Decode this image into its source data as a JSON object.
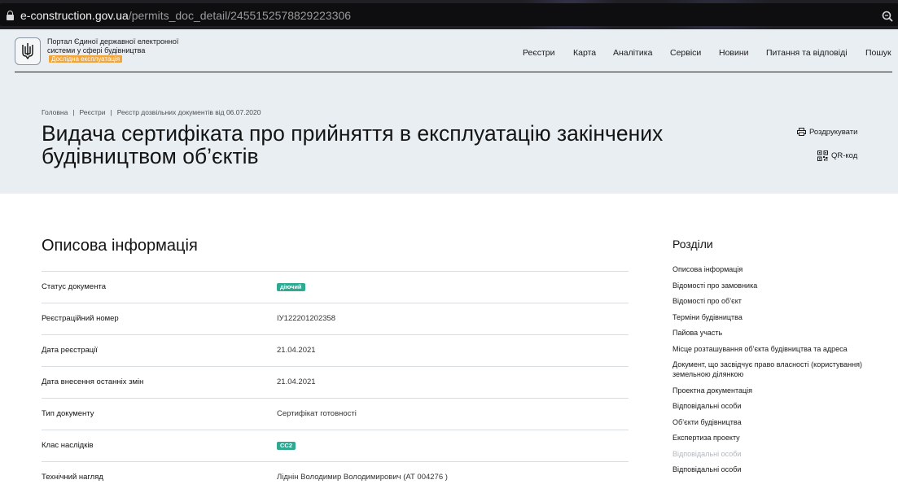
{
  "browser": {
    "url_host": "e-construction.gov.ua",
    "url_path": "/permits_doc_detail/2455152578829223306"
  },
  "header": {
    "portal_name": "Портал Єдиної державної електронної системи у сфері будівництва",
    "beta_label": "Дослідна експлуатація",
    "nav": [
      "Реєстри",
      "Карта",
      "Аналітика",
      "Сервіси",
      "Новини",
      "Питання та відповіді",
      "Пошук"
    ]
  },
  "breadcrumb": [
    "Головна",
    "Реєстри",
    "Реєстр дозвільних документів від 06.07.2020"
  ],
  "page_title": "Видача сертифіката про прийняття в експлуатацію закінчених будівництвом об’єктів",
  "actions": {
    "print": "Роздрукувати",
    "qr": "QR-код"
  },
  "main": {
    "section_title": "Описова інформація",
    "rows": [
      {
        "label": "Статус документа",
        "value": "діючий",
        "badge": true
      },
      {
        "label": "Реєстраційний номер",
        "value": "ІУ122201202358"
      },
      {
        "label": "Дата реєстрації",
        "value": "21.04.2021"
      },
      {
        "label": "Дата внесення останніх змін",
        "value": "21.04.2021"
      },
      {
        "label": "Тип документу",
        "value": "Сертифікат готовності"
      },
      {
        "label": "Клас наслідків",
        "value": "СС2",
        "badge": true
      },
      {
        "label": "Технічний нагляд",
        "value": "Ліднін Володимир Володимирович (АТ 004276 )"
      }
    ]
  },
  "toc": {
    "title": "Розділи",
    "items": [
      "Описова інформація",
      "Відомості про замовника",
      "Відомості про об’єкт",
      "Терміни будівництва",
      "Пайова участь",
      "Місце розташування об’єкта будівництва та адреса",
      "Документ, що засвідчує право власності (користування) земельною ділянкою",
      "Проектна документація",
      "Відповідальні особи",
      "Об’єкти будівництва",
      "Експертиза проекту",
      "Відповідальні особи",
      "Відповідальні особи"
    ]
  },
  "colors": {
    "header_bg": "#e9eef2",
    "badge_green": "#2eaa93",
    "beta_orange": "#f0a63c"
  }
}
